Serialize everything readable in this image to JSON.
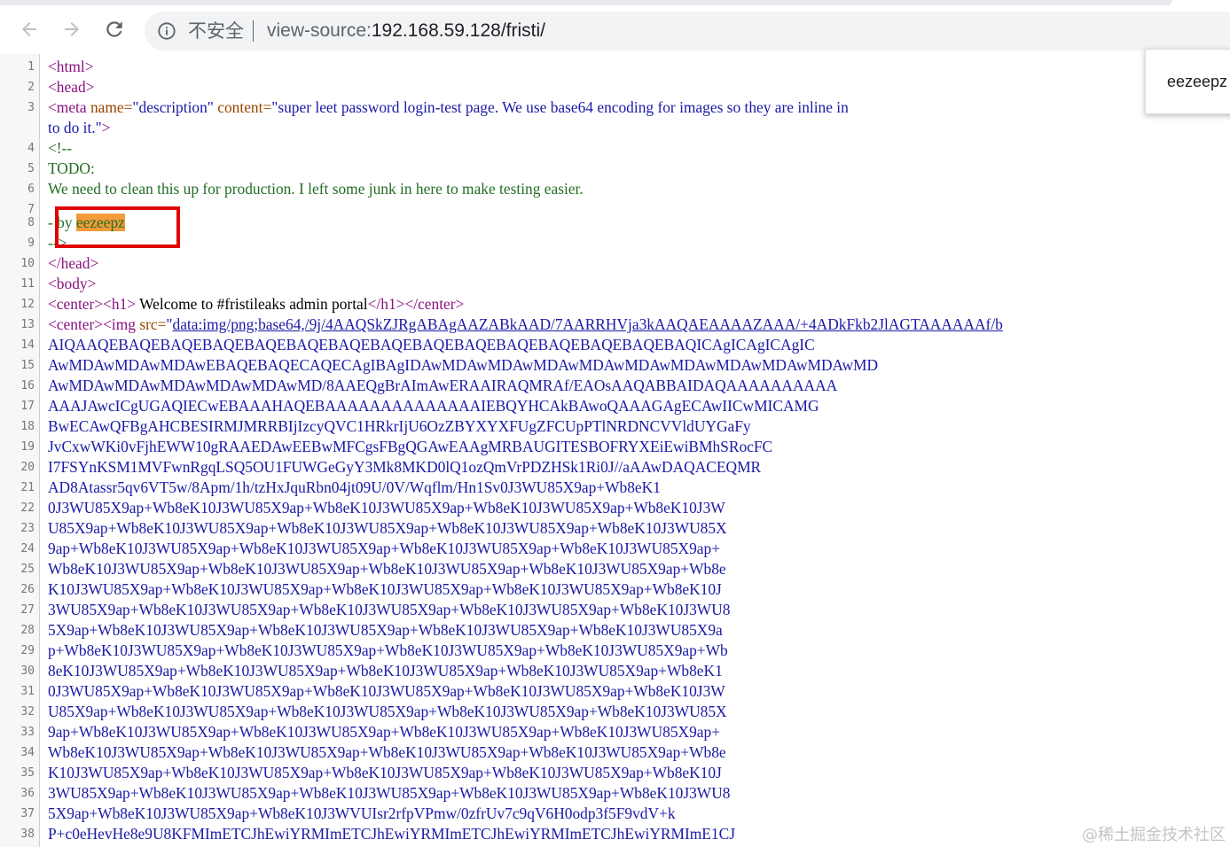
{
  "browser": {
    "security_label": "不安全",
    "url_scheme": "view-source:",
    "url_host": "192.168.59.128/fristi/"
  },
  "find_popup": {
    "text": "eezeepz"
  },
  "watermark": "@稀土掘金技术社区",
  "source": {
    "l1": "<html>",
    "l2": "<head>",
    "l3_tag": "<meta ",
    "l3_attr1": "name=",
    "l3_val1": "\"description\"",
    "l3_attr2": " content=",
    "l3_val2": "\"super leet password login-test page. We use base64 encoding for images so they are inline in",
    "l3b_val": "to do it.\"",
    "l3b_tag": ">",
    "l4": "<!--",
    "l5": "TODO:",
    "l6": "We need to clean this up for production. I left some junk in here to make testing easier.",
    "l8_pre": "- by ",
    "l8_hl": "eezeepz",
    "l9": "-->",
    "l10": "</head>",
    "l11": "<body>",
    "l12_tag1": "<center><h1>",
    "l12_text": " Welcome to #fristileaks admin portal",
    "l12_tag2": "</h1></center>",
    "l13_tag1": "<center><img ",
    "l13_attr": "src=",
    "l13_val": "\"",
    "l13_link": "data:img/png;base64,/9j/4AAQSkZJRgABAgAAZABkAAD/7AARRHVja3kAAQAEAAAAZAAA/+4ADkFkb2JlAGTAAAAAAf/b",
    "b64": [
      "AIQAAQEBAQEBAQEBAQEBAQEBAQEBAQEBAQEBAQEBAQEBAQEBAQEBAQEBAQEBAQICAgICAgICAgIC",
      "AwMDAwMDAwMDAwEBAQEBAQECAQECAgIBAgIDAwMDAwMDAwMDAwMDAwMDAwMDAwMDAwMDAwMDAwMD",
      "AwMDAwMDAwMDAwMDAwMDAwMD/8AAEQgBrAImAwERAAIRAQMRAf/EAOsAAQABBAIDAQAAAAAAAAAA",
      "AAAJAwcICgUGAQIECwEBAAAHAQEBAAAAAAAAAAAAAAIEBQYHCAkBAwoQAAAGAgECAwIICwMICAMG",
      "BwECAwQFBgAHCBESIRMJMRRBIjIzcyQVC1HRkrIjU6OzZBYXYXFUgZFCUpPTlNRDNCVVldUYGaFy",
      "JvCxwWKi0vFjhEWW10gRAAEDAwEEBwMFCgsFBgQGAwEAAgMRBAUGITESBOFRYXEiEwiBMhSRocFC",
      "I7FSYnKSM1MVFwnRgqLSQ5OU1FUWGeGyY3Mk8MKD0lQ1ozQmVrPDZHSk1Ri0J//aAAwDAQACEQMR",
      "AD8Atassr5qv6VT5w/8Apm/1h/tzHxJquRbn04jt09U/0V/Wqflm/Hn1Sv0J3WU85X9ap+Wb8eK1",
      "0J3WU85X9ap+Wb8eK10J3WU85X9ap+Wb8eK10J3WU85X9ap+Wb8eK10J3WU85X9ap+Wb8eK10J3W",
      "U85X9ap+Wb8eK10J3WU85X9ap+Wb8eK10J3WU85X9ap+Wb8eK10J3WU85X9ap+Wb8eK10J3WU85X",
      "9ap+Wb8eK10J3WU85X9ap+Wb8eK10J3WU85X9ap+Wb8eK10J3WU85X9ap+Wb8eK10J3WU85X9ap+",
      "Wb8eK10J3WU85X9ap+Wb8eK10J3WU85X9ap+Wb8eK10J3WU85X9ap+Wb8eK10J3WU85X9ap+Wb8e",
      "K10J3WU85X9ap+Wb8eK10J3WU85X9ap+Wb8eK10J3WU85X9ap+Wb8eK10J3WU85X9ap+Wb8eK10J",
      "3WU85X9ap+Wb8eK10J3WU85X9ap+Wb8eK10J3WU85X9ap+Wb8eK10J3WU85X9ap+Wb8eK10J3WU8",
      "5X9ap+Wb8eK10J3WU85X9ap+Wb8eK10J3WU85X9ap+Wb8eK10J3WU85X9ap+Wb8eK10J3WU85X9a",
      "p+Wb8eK10J3WU85X9ap+Wb8eK10J3WU85X9ap+Wb8eK10J3WU85X9ap+Wb8eK10J3WU85X9ap+Wb",
      "8eK10J3WU85X9ap+Wb8eK10J3WU85X9ap+Wb8eK10J3WU85X9ap+Wb8eK10J3WU85X9ap+Wb8eK1",
      "0J3WU85X9ap+Wb8eK10J3WU85X9ap+Wb8eK10J3WU85X9ap+Wb8eK10J3WU85X9ap+Wb8eK10J3W",
      "U85X9ap+Wb8eK10J3WU85X9ap+Wb8eK10J3WU85X9ap+Wb8eK10J3WU85X9ap+Wb8eK10J3WU85X",
      "9ap+Wb8eK10J3WU85X9ap+Wb8eK10J3WU85X9ap+Wb8eK10J3WU85X9ap+Wb8eK10J3WU85X9ap+",
      "Wb8eK10J3WU85X9ap+Wb8eK10J3WU85X9ap+Wb8eK10J3WU85X9ap+Wb8eK10J3WU85X9ap+Wb8e",
      "K10J3WU85X9ap+Wb8eK10J3WU85X9ap+Wb8eK10J3WU85X9ap+Wb8eK10J3WU85X9ap+Wb8eK10J",
      "3WU85X9ap+Wb8eK10J3WU85X9ap+Wb8eK10J3WU85X9ap+Wb8eK10J3WU85X9ap+Wb8eK10J3WU8",
      "5X9ap+Wb8eK10J3WU85X9ap+Wb8eK10J3WVUIsr2rfpVPmw/0zfrUv7c9qV6H0odp3f5F9vdV+k",
      "P+c0eHevHe8e9U8KFMImETCJhEwiYRMImETCJhEwiYRMImETCJhEwiYRMImETCJhEwiYRMImE1CJ"
    ]
  }
}
